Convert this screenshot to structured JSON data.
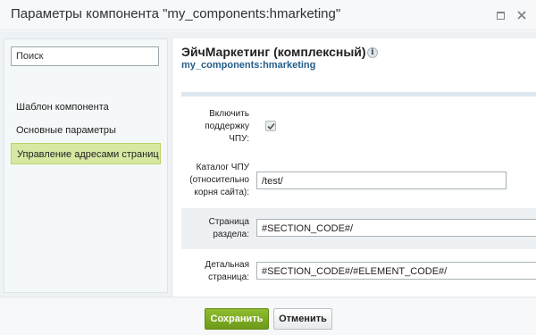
{
  "window": {
    "title": "Параметры компонента \"my_components:hmarketing\""
  },
  "sidebar": {
    "search_placeholder": "Поиск",
    "items": [
      {
        "label": "Шаблон компонента"
      },
      {
        "label": "Основные параметры"
      },
      {
        "label": "Управление адресами страниц",
        "active": true
      }
    ]
  },
  "component": {
    "title": "ЭйчМаркетинг (комплексный)",
    "code": "my_components:hmarketing",
    "info_icon": "info-icon"
  },
  "form": {
    "sef_enable": {
      "label_line1": "Включить",
      "label_line2": "поддержку",
      "label_line3": "ЧПУ:",
      "checked": true
    },
    "sef_folder": {
      "label_line1": "Каталог ЧПУ",
      "label_line2": "(относительно",
      "label_line3": "корня сайта):",
      "value": "/test/"
    },
    "section_page": {
      "label_line1": "Страница",
      "label_line2": "раздела:",
      "value": "#SECTION_CODE#/"
    },
    "detail_page": {
      "label_line1": "Детальная",
      "label_line2": "страница:",
      "value": "#SECTION_CODE#/#ELEMENT_CODE#/"
    }
  },
  "footer": {
    "save_label": "Сохранить",
    "cancel_label": "Отменить"
  },
  "colors": {
    "accent_green": "#7aa823",
    "link_blue": "#245e8a",
    "active_nav": "#d7e8a3"
  }
}
